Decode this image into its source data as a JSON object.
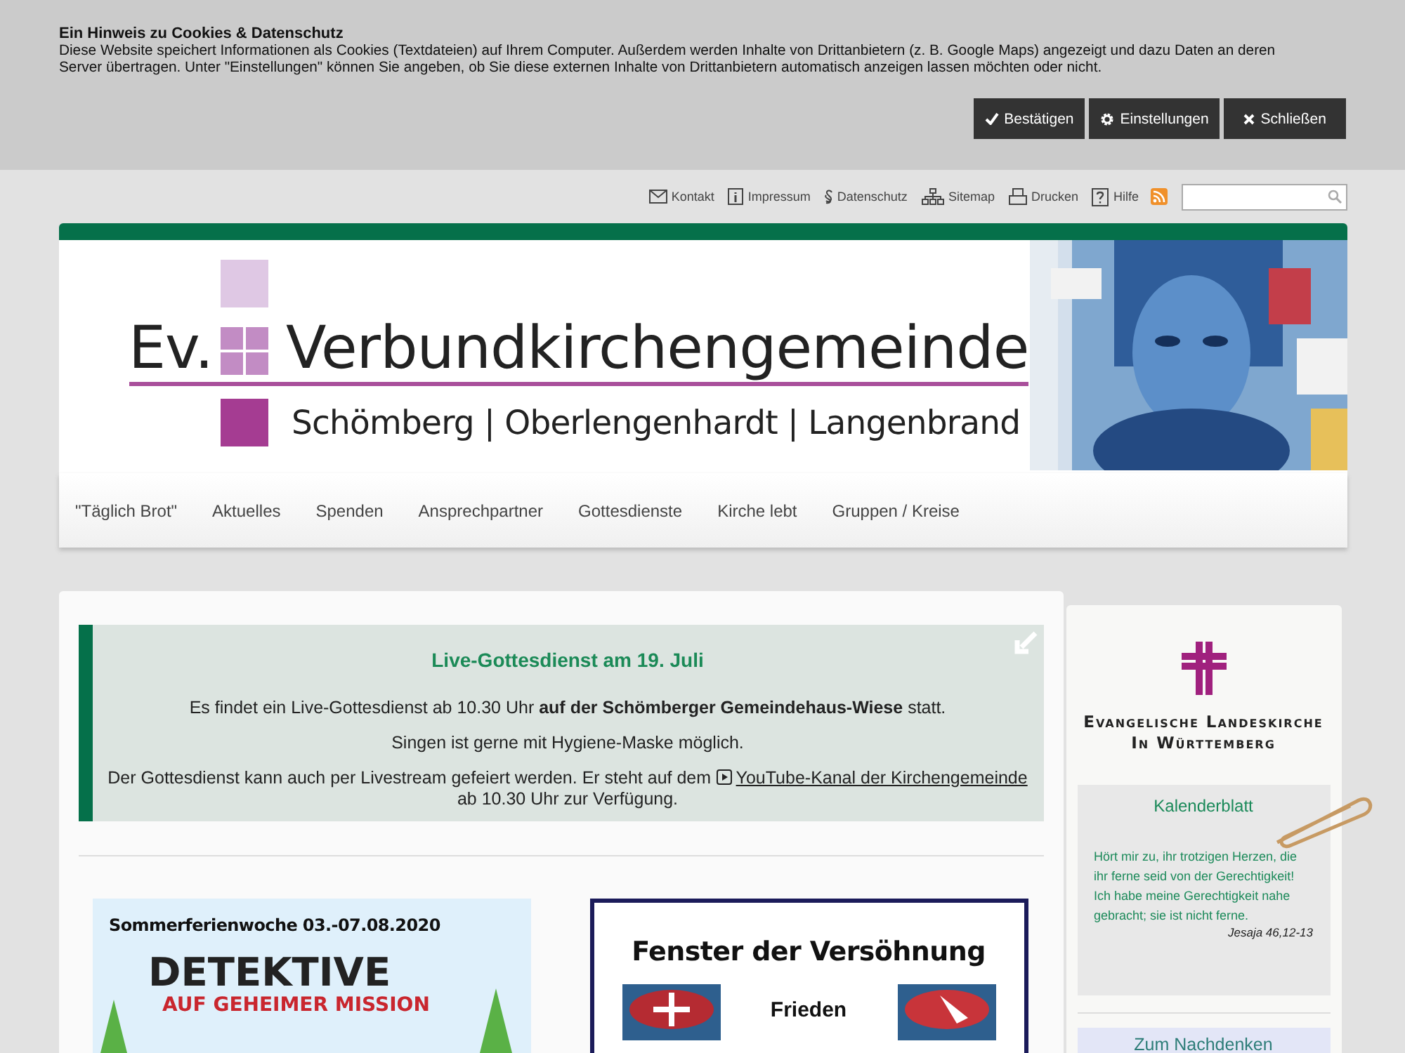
{
  "cookie_notice": {
    "title": "Ein Hinweis zu Cookies & Datenschutz",
    "text": "Diese Website speichert Informationen als Cookies (Textdateien) auf Ihrem Computer. Außerdem werden Inhalte von Drittanbietern (z. B. Google Maps) angezeigt und dazu Daten an deren Server übertragen. Unter \"Einstellungen\" können Sie angeben, ob Sie diese externen Inhalte von Drittanbietern automatisch anzeigen lassen möchten oder nicht.",
    "buttons": [
      {
        "label": "Bestätigen",
        "kind": "confirm"
      },
      {
        "label": "Einstellungen",
        "kind": "settings"
      },
      {
        "label": "Schließen",
        "kind": "close"
      }
    ]
  },
  "top_links": [
    {
      "label": "Kontakt",
      "kind": "mail"
    },
    {
      "label": "Impressum",
      "kind": "info"
    },
    {
      "label": "Datenschutz",
      "kind": "paragraph"
    },
    {
      "label": "Sitemap",
      "kind": "sitemap"
    },
    {
      "label": "Drucken",
      "kind": "print"
    },
    {
      "label": "Hilfe",
      "kind": "help"
    }
  ],
  "logo": {
    "prefix": "Ev.",
    "name": "Verbundkirchengemeinde",
    "subtitle": "Schömberg | Oberlengenhardt | Langenbrand"
  },
  "nav": [
    "\"Täglich Brot\"",
    "Aktuelles",
    "Spenden",
    "Ansprechpartner",
    "Gottesdienste",
    "Kirche lebt",
    "Gruppen / Kreise"
  ],
  "notice": {
    "title": "Live-Gottesdienst am 19. Juli",
    "paragraphs": [
      "Es findet ein Live-Gottesdienst ab 10.30 Uhr **auf der Schömberger Gemeindehaus-Wiese** statt.",
      "Singen ist gerne mit Hygiene-Maske möglich."
    ],
    "stream_text": "Der Gottesdienst kann auch per Livestream gefeiert werden. Er steht auf dem",
    "stream_link": "YouTube-Kanal der Kirchengemeinde",
    "stream_after": "ab 10.30 Uhr zur Verfügung."
  },
  "teasers": [
    {
      "kind": "holiday",
      "heading": "Sommerferienwoche 03.-07.08.2020",
      "title": "DETEKTIVE",
      "subtitle": "AUF GEHEIMER MISSION"
    },
    {
      "kind": "window",
      "title": "Fenster der Versöhnung",
      "word": "Frieden"
    }
  ],
  "sidebar": {
    "church": [
      "Evangelische Landeskirche",
      "In Württemberg"
    ],
    "calendar": {
      "title": "Kalenderblatt",
      "quote": "Hört mir zu, ihr trotzigen Herzen, die ihr ferne seid von der Gerechtigkeit! Ich habe meine Gerechtigkeit nahe gebracht; sie ist nicht ferne.",
      "source": "Jesaja 46,12-13"
    },
    "next_title": "Zum Nachdenken"
  }
}
